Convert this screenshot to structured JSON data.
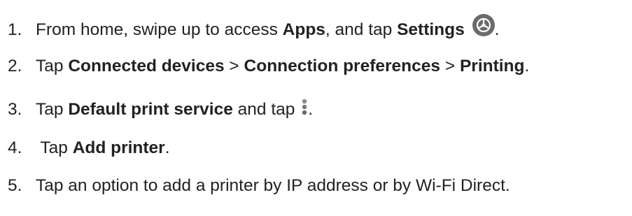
{
  "steps": [
    {
      "number": "1.",
      "t1": "From home, swipe up to access ",
      "b1": "Apps",
      "t2": ", and tap ",
      "b2": "Settings",
      "t3": "."
    },
    {
      "number": "2.",
      "t1": "Tap ",
      "b1": "Connected devices",
      "t2": " > ",
      "b2": "Connection preferences",
      "t3": " > ",
      "b3": "Printing",
      "t4": "."
    },
    {
      "number": "3.",
      "t1": "Tap ",
      "b1": "Default print service",
      "t2": " and tap ",
      "t3": "."
    },
    {
      "number": "4.",
      "t1": " Tap ",
      "b1": "Add printer",
      "t2": "."
    },
    {
      "number": "5.",
      "t1": "Tap an option to add a printer by IP address or by Wi-Fi Direct."
    }
  ],
  "icons": {
    "settings": "settings-gear-icon",
    "menu": "more-options-icon"
  },
  "colors": {
    "text": "#222222",
    "icon_fill": "#6b6b6b"
  }
}
